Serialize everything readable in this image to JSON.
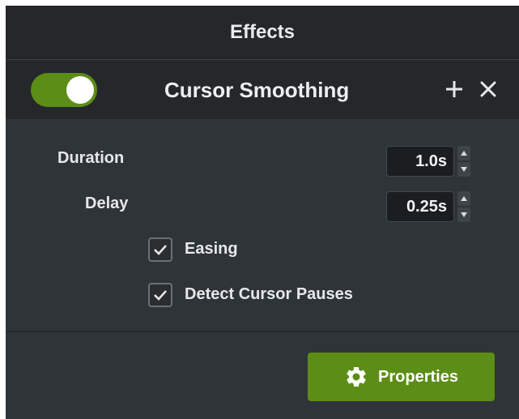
{
  "header": {
    "title": "Effects"
  },
  "effect": {
    "name": "Cursor Smoothing",
    "enabled": true,
    "add_icon": "plus-icon",
    "close_icon": "close-icon"
  },
  "params": {
    "duration": {
      "label": "Duration",
      "value": "1.0s"
    },
    "delay": {
      "label": "Delay",
      "value": "0.25s"
    }
  },
  "options": {
    "easing": {
      "label": "Easing",
      "checked": true
    },
    "detect_pauses": {
      "label": "Detect Cursor Pauses",
      "checked": true
    }
  },
  "footer": {
    "properties_label": "Properties",
    "properties_icon": "gear-icon"
  },
  "colors": {
    "accent": "#5c8d16",
    "panel_bg": "#2f3438",
    "bar_bg": "#24282b"
  }
}
